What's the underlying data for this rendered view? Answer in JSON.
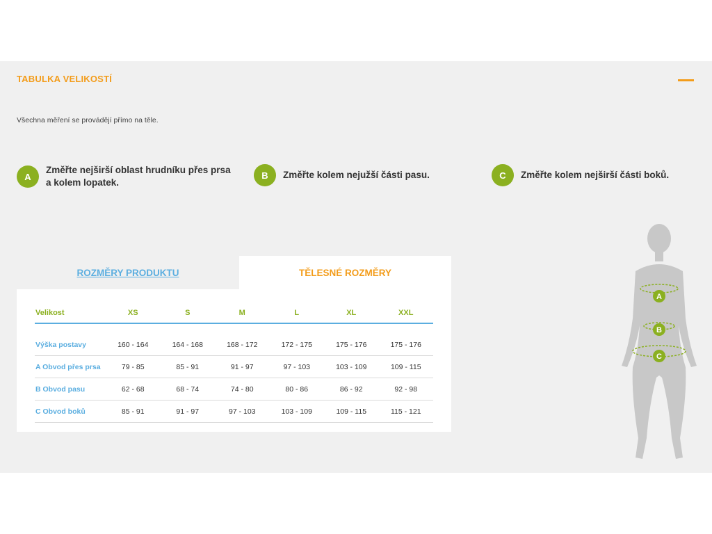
{
  "panel": {
    "title": "TABULKA VELIKOSTÍ",
    "note": "Všechna měření se provádějí přímo na těle."
  },
  "steps": [
    {
      "badge": "A",
      "text_line1": "Změřte nejširší oblast hrudníku přes prsa",
      "text_line2": "a kolem lopatek."
    },
    {
      "badge": "B",
      "text_line1": "Změřte kolem nejužší části pasu."
    },
    {
      "badge": "C",
      "text_line1": "Změřte kolem nejširší části boků."
    }
  ],
  "tabs": [
    {
      "label": "ROZMĚRY PRODUKTU",
      "active": false
    },
    {
      "label": "TĚLESNÉ ROZMĚRY",
      "active": true
    }
  ],
  "table": {
    "headers": [
      "Velikost",
      "XS",
      "S",
      "M",
      "L",
      "XL",
      "XXL"
    ],
    "rows": [
      {
        "label": "Výška postavy",
        "values": [
          "160 - 164",
          "164 - 168",
          "168 - 172",
          "172 - 175",
          "175 - 176",
          "175 - 176"
        ]
      },
      {
        "label": "A Obvod přes prsa",
        "values": [
          "79 - 85",
          "85 - 91",
          "91 - 97",
          "97 - 103",
          "103 - 109",
          "109 - 115"
        ]
      },
      {
        "label": "B Obvod pasu",
        "values": [
          "62 - 68",
          "68 - 74",
          "74 - 80",
          "80 - 86",
          "86 - 92",
          "92 - 98"
        ]
      },
      {
        "label": "C Obvod boků",
        "values": [
          "85 - 91",
          "91 - 97",
          "97 - 103",
          "103 - 109",
          "109 - 115",
          "115 - 121"
        ]
      }
    ]
  },
  "figure": {
    "markers": [
      "A",
      "B",
      "C"
    ]
  },
  "colors": {
    "accent": "#f39c1a",
    "badge": "#8bb020",
    "link": "#5baee0",
    "panel_bg": "#f0f0f0",
    "silhouette": "#c8c8c8"
  },
  "icons": {
    "collapse": "minus-icon"
  }
}
